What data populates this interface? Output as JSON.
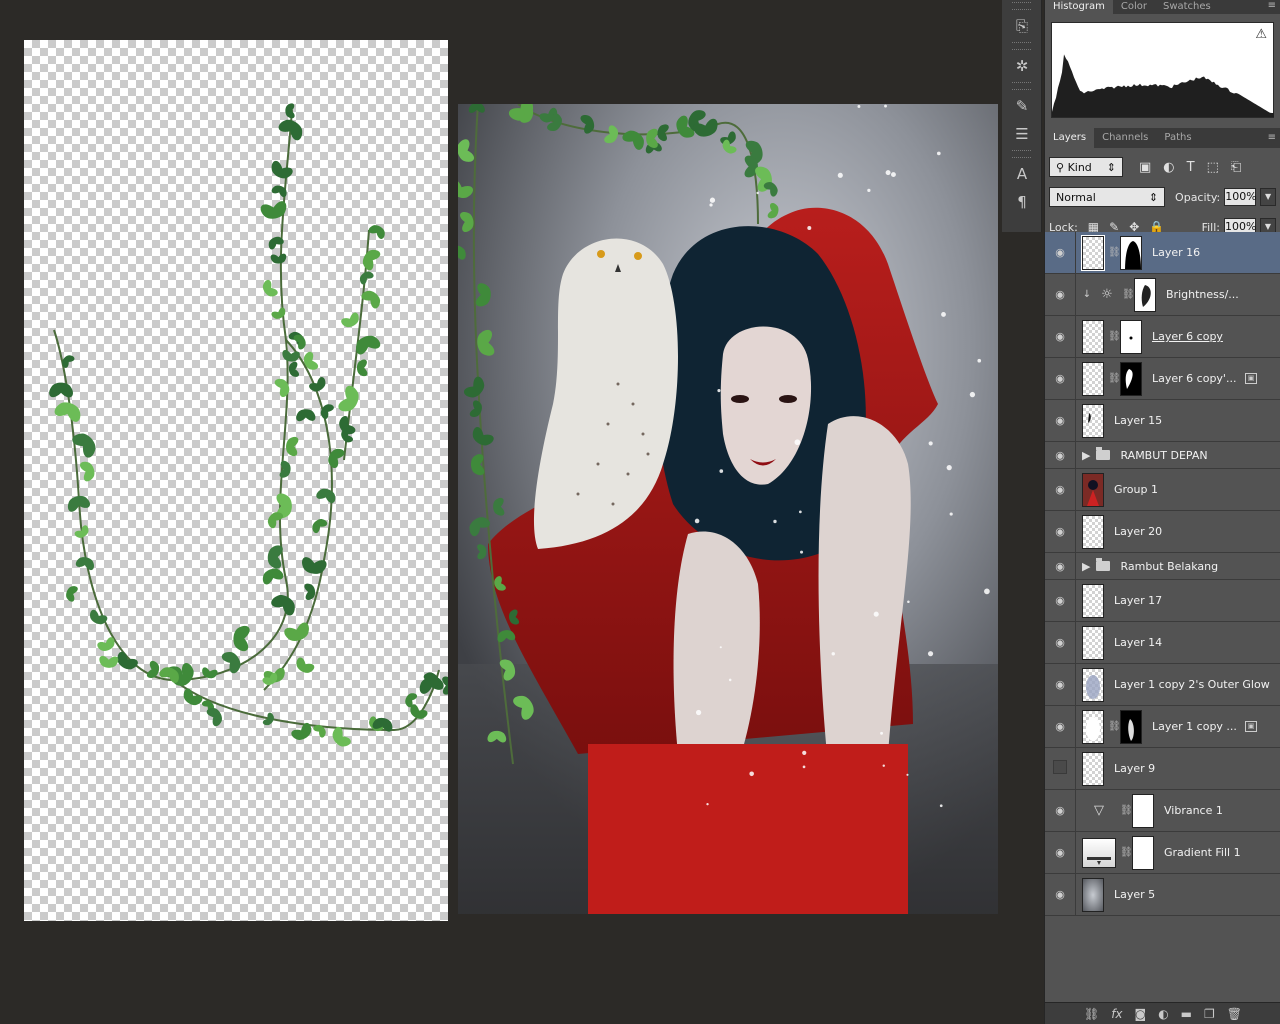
{
  "histogram_panel": {
    "tabs": [
      "Histogram",
      "Color",
      "Swatches"
    ],
    "active_tab": "Histogram",
    "warning_glyph": "⚠"
  },
  "layers_panel": {
    "tabs": [
      "Layers",
      "Channels",
      "Paths"
    ],
    "active_tab": "Layers",
    "filter_kind": "Kind",
    "blend_mode": "Normal",
    "opacity_label": "Opacity:",
    "opacity_value": "100%",
    "lock_label": "Lock:",
    "fill_label": "Fill:",
    "fill_value": "100%",
    "layers": [
      {
        "name": "Layer 16",
        "visible": true,
        "selected": true
      },
      {
        "name": "Brightness/...",
        "visible": true
      },
      {
        "name": "Layer 6 copy",
        "visible": true
      },
      {
        "name": "Layer 6 copy'...",
        "visible": true
      },
      {
        "name": "Layer 15",
        "visible": true
      },
      {
        "name": "RAMBUT DEPAN",
        "visible": true,
        "group": true
      },
      {
        "name": "Group 1",
        "visible": true
      },
      {
        "name": "Layer 20",
        "visible": true
      },
      {
        "name": "Rambut Belakang",
        "visible": true,
        "group": true
      },
      {
        "name": "Layer 17",
        "visible": true
      },
      {
        "name": "Layer 14",
        "visible": true
      },
      {
        "name": "Layer 1 copy 2's Outer Glow",
        "visible": true
      },
      {
        "name": "Layer 1 copy ...",
        "visible": true
      },
      {
        "name": "Layer 9",
        "visible": false
      },
      {
        "name": "Vibrance 1",
        "visible": true
      },
      {
        "name": "Gradient Fill 1",
        "visible": true
      },
      {
        "name": "Layer 5",
        "visible": true
      }
    ]
  },
  "colors": {
    "workspace_bg": "#2c2a27",
    "panel_bg": "#535353",
    "selected_layer": "#596b86",
    "ivy_green": "#3f8a3a"
  },
  "icons": {
    "tools": [
      "history-icon",
      "navigator-icon",
      "brush-presets-icon",
      "properties-icon",
      "character-icon",
      "paragraph-icon"
    ],
    "footer": [
      "link-icon",
      "fx-icon",
      "mask-icon",
      "adjustment-icon",
      "folder-icon",
      "new-layer-icon",
      "trash-icon"
    ]
  }
}
